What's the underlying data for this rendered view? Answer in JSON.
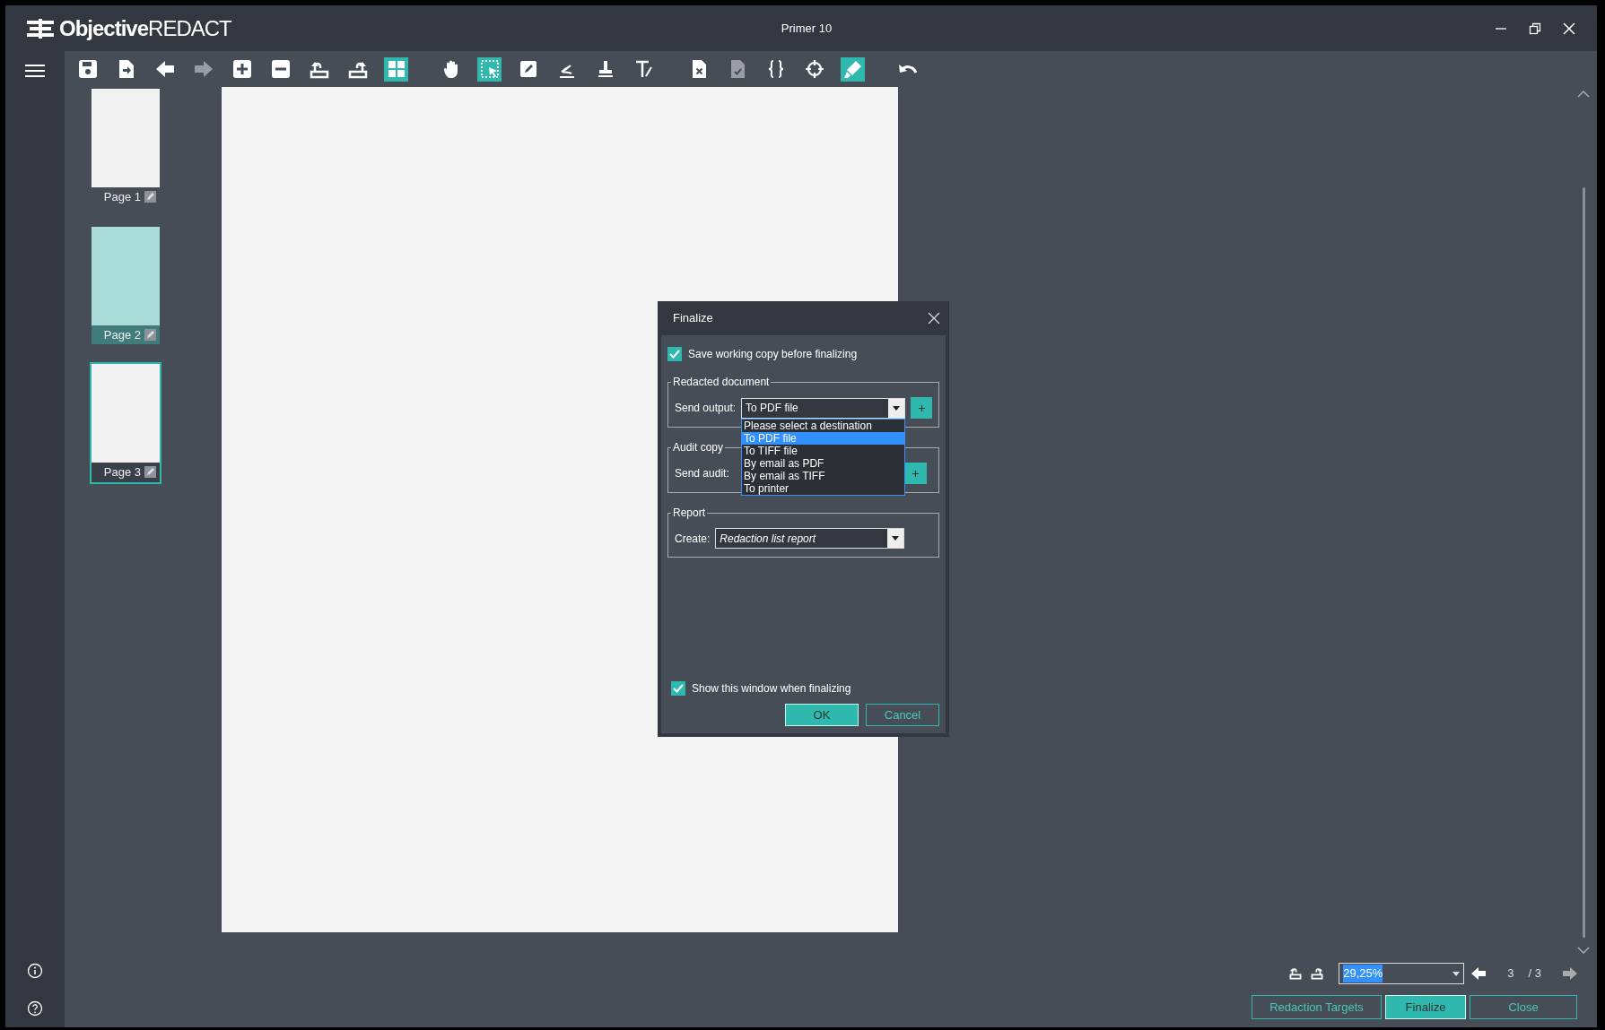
{
  "window": {
    "logo_bold": "Objective",
    "logo_light": "REDACT",
    "title": "Primer 10"
  },
  "toolbar": [
    {
      "items": [
        {
          "kind": "save",
          "selected": false,
          "disabled": false
        },
        {
          "kind": "export",
          "selected": false,
          "disabled": false
        },
        {
          "kind": "back",
          "selected": false,
          "disabled": false
        },
        {
          "kind": "forward",
          "selected": false,
          "disabled": true
        },
        {
          "kind": "zoom-in",
          "selected": false,
          "disabled": false
        },
        {
          "kind": "zoom-out",
          "selected": false,
          "disabled": false
        },
        {
          "kind": "rotate-left",
          "selected": false,
          "disabled": false
        },
        {
          "kind": "rotate-right",
          "selected": false,
          "disabled": false
        },
        {
          "kind": "thumbnails",
          "selected": true,
          "disabled": false
        }
      ]
    },
    {
      "items": [
        {
          "kind": "pan",
          "selected": false,
          "disabled": false
        },
        {
          "kind": "select",
          "selected": true,
          "disabled": false
        },
        {
          "kind": "pencil",
          "selected": false,
          "disabled": false
        },
        {
          "kind": "sign",
          "selected": false,
          "disabled": false
        },
        {
          "kind": "stamp",
          "selected": false,
          "disabled": false
        },
        {
          "kind": "text",
          "selected": false,
          "disabled": false
        }
      ]
    },
    {
      "items": [
        {
          "kind": "doc-x",
          "selected": false,
          "disabled": false
        },
        {
          "kind": "doc-check",
          "selected": false,
          "disabled": true
        },
        {
          "kind": "braces",
          "selected": false,
          "disabled": false
        },
        {
          "kind": "target",
          "selected": false,
          "disabled": false
        },
        {
          "kind": "highlight",
          "selected": true,
          "disabled": false
        }
      ]
    },
    {
      "items": [
        {
          "kind": "undo",
          "selected": false,
          "disabled": false
        }
      ]
    }
  ],
  "pages": [
    {
      "label": "Page 1",
      "highlighted": false,
      "selected": false
    },
    {
      "label": "Page 2",
      "highlighted": true,
      "selected": false
    },
    {
      "label": "Page 3",
      "highlighted": false,
      "selected": true
    }
  ],
  "dialog": {
    "title": "Finalize",
    "save_copy": {
      "label": "Save working copy before finalizing",
      "checked": true
    },
    "redacted": {
      "legend": "Redacted document",
      "label": "Send output:",
      "value": "To PDF file",
      "options": [
        {
          "label": "Please select a destination",
          "selected": false
        },
        {
          "label": "To PDF file",
          "selected": true
        },
        {
          "label": "To TIFF file",
          "selected": false
        },
        {
          "label": "By email as PDF",
          "selected": false
        },
        {
          "label": "By email as TIFF",
          "selected": false
        },
        {
          "label": "To printer",
          "selected": false
        }
      ]
    },
    "audit": {
      "legend": "Audit copy",
      "label": "Send audit:"
    },
    "report": {
      "legend": "Report",
      "label": "Create:",
      "value": "Redaction list report"
    },
    "show_window": {
      "label": "Show this window when finalizing",
      "checked": true
    },
    "buttons": [
      {
        "label": "OK",
        "primary": true
      },
      {
        "label": "Cancel",
        "primary": false
      }
    ]
  },
  "footer": {
    "zoom": "29,25%",
    "page": "3",
    "total": "/ 3",
    "buttons": [
      {
        "label": "Redaction Targets",
        "primary": false
      },
      {
        "label": "Finalize",
        "primary": true
      },
      {
        "label": "Close",
        "primary": false
      }
    ]
  }
}
